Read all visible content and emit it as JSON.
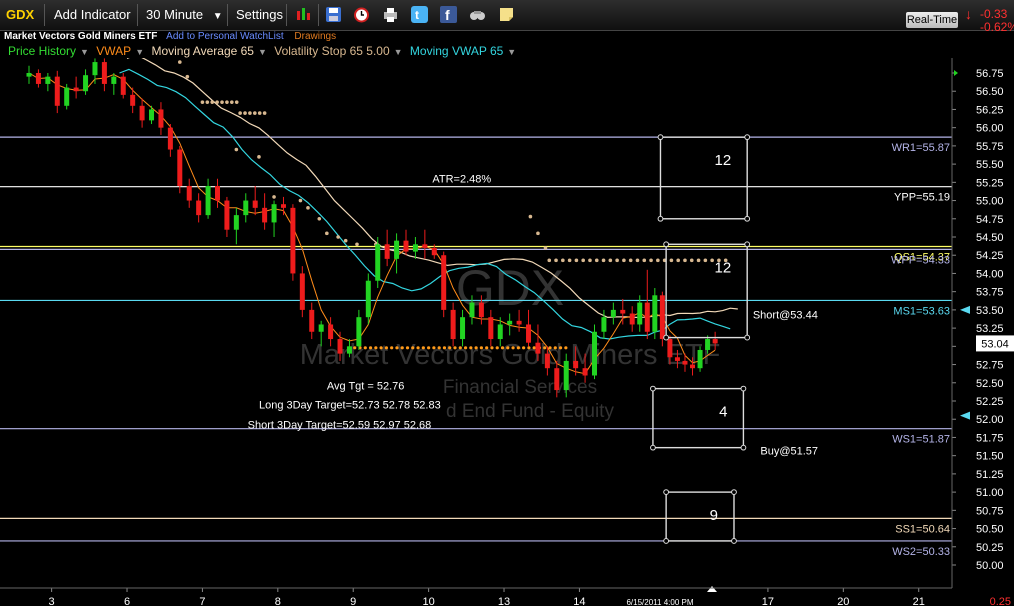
{
  "toolbar": {
    "symbol": "GDX",
    "add_indicator": "Add Indicator",
    "interval": "30 Minute",
    "settings": "Settings",
    "realtime": "Real-Time",
    "change_abs": "-0.33",
    "change_pct": "-0.62%"
  },
  "subheader": {
    "name": "Market Vectors Gold Miners ETF",
    "watchlist": "Add to Personal WatchList",
    "drawings": "Drawings"
  },
  "legend": [
    {
      "label": "Price History",
      "color": "#33dd33"
    },
    {
      "label": "VWAP",
      "color": "#ff8c1a"
    },
    {
      "label": "Moving Average 65",
      "color": "#f2d9b8"
    },
    {
      "label": "Volatility Stop 65 5.00",
      "color": "#d8b890"
    },
    {
      "label": "Moving VWAP 65",
      "color": "#33d6e0"
    }
  ],
  "watermark": {
    "symbol": "GDX",
    "name": "Market Vectors Gold Miners ETF",
    "sector": "Financial Services",
    "type": "d End Fund - Equity"
  },
  "chart_data": {
    "type": "candlestick",
    "ylim": [
      50.0,
      56.85
    ],
    "y_ticks": [
      "56.75",
      "56.50",
      "56.25",
      "56.00",
      "55.75",
      "55.50",
      "55.25",
      "55.00",
      "54.75",
      "54.50",
      "54.25",
      "54.00",
      "53.75",
      "53.50",
      "53.25",
      "53.00",
      "52.75",
      "52.50",
      "52.25",
      "52.00",
      "51.75",
      "51.50",
      "51.25",
      "51.00",
      "50.75",
      "50.50",
      "50.25",
      "50.00"
    ],
    "x_ticks": [
      "3",
      "6",
      "7",
      "8",
      "9",
      "10",
      "13",
      "14",
      "17",
      "20",
      "21"
    ],
    "x_tick_positions": [
      1,
      3,
      5,
      7,
      9,
      11,
      13,
      15,
      20,
      22,
      24
    ],
    "x_date_label": "6/15/2011 4:00 PM",
    "corner_label": "0.25",
    "last_price": "53.04",
    "last_price_value": 53.04,
    "levels": [
      {
        "label": "WR1=55.87",
        "value": 55.87,
        "color": "#b4b4e8"
      },
      {
        "label": "YPP=55.19",
        "value": 55.19,
        "color": "#ffffff"
      },
      {
        "label": "QS1=54.37",
        "value": 54.37,
        "color": "#ffff66"
      },
      {
        "label": "WPP=54.33",
        "value": 54.33,
        "color": "#b4b4e8"
      },
      {
        "label": "MS1=53.63",
        "value": 53.63,
        "color": "#5ad9f0"
      },
      {
        "label": "WS1=51.87",
        "value": 51.87,
        "color": "#b4b4e8"
      },
      {
        "label": "SS1=50.64",
        "value": 50.64,
        "color": "#f2d9b8"
      },
      {
        "label": "WS2=50.33",
        "value": 50.33,
        "color": "#b4b4e8"
      }
    ],
    "annotations": [
      {
        "text": "ATR=2.48%",
        "x": 10.7,
        "y": 55.3
      },
      {
        "text": "Short@53.44",
        "x": 19.2,
        "y": 53.44
      },
      {
        "text": "Buy@51.57",
        "x": 19.4,
        "y": 51.57
      },
      {
        "text": "Avg Tgt = 52.76",
        "x": 7.9,
        "y": 52.46
      },
      {
        "text": "Long 3Day Target=52.73 52.78 52.83",
        "x": 6.1,
        "y": 52.2
      },
      {
        "text": "Short 3Day Target=52.59 52.97 52.68",
        "x": 5.8,
        "y": 51.93
      }
    ],
    "boxes": [
      {
        "number": "12",
        "x0": 16.75,
        "x1": 19.05,
        "y0": 55.87,
        "y1": 54.75
      },
      {
        "number": "12",
        "x0": 16.9,
        "x1": 19.05,
        "y0": 54.4,
        "y1": 53.12
      },
      {
        "number": "4",
        "x0": 16.55,
        "x1": 18.95,
        "y0": 52.42,
        "y1": 51.61
      },
      {
        "number": "9",
        "x0": 16.9,
        "x1": 18.7,
        "y0": 51.0,
        "y1": 50.33
      }
    ],
    "candles": [
      [
        0,
        56.7,
        56.85,
        56.6,
        56.75
      ],
      [
        0.25,
        56.75,
        56.8,
        56.55,
        56.6
      ],
      [
        0.5,
        56.6,
        56.75,
        56.5,
        56.7
      ],
      [
        0.75,
        56.7,
        56.78,
        56.2,
        56.3
      ],
      [
        1,
        56.3,
        56.6,
        56.25,
        56.55
      ],
      [
        1.25,
        56.55,
        56.7,
        56.4,
        56.5
      ],
      [
        1.5,
        56.5,
        56.8,
        56.45,
        56.72
      ],
      [
        1.75,
        56.72,
        56.95,
        56.6,
        56.9
      ],
      [
        2,
        56.9,
        56.95,
        56.5,
        56.6
      ],
      [
        2.25,
        56.6,
        56.75,
        56.45,
        56.7
      ],
      [
        2.5,
        56.7,
        56.75,
        56.4,
        56.45
      ],
      [
        2.75,
        56.45,
        56.55,
        56.2,
        56.3
      ],
      [
        3,
        56.3,
        56.4,
        56.0,
        56.1
      ],
      [
        3.25,
        56.1,
        56.3,
        56.05,
        56.25
      ],
      [
        3.5,
        56.25,
        56.35,
        55.9,
        56.0
      ],
      [
        3.75,
        56.0,
        56.05,
        55.6,
        55.7
      ],
      [
        4,
        55.7,
        55.75,
        55.1,
        55.2
      ],
      [
        4.25,
        55.2,
        55.3,
        54.9,
        55.0
      ],
      [
        4.5,
        55.0,
        55.1,
        54.7,
        54.8
      ],
      [
        4.75,
        54.8,
        55.3,
        54.75,
        55.2
      ],
      [
        5,
        55.2,
        55.3,
        54.9,
        55.0
      ],
      [
        5.25,
        55.0,
        55.05,
        54.5,
        54.6
      ],
      [
        5.5,
        54.6,
        54.9,
        54.4,
        54.8
      ],
      [
        5.75,
        54.8,
        55.1,
        54.7,
        55.0
      ],
      [
        6,
        55.0,
        55.2,
        54.8,
        54.9
      ],
      [
        6.25,
        54.9,
        55.1,
        54.6,
        54.7
      ],
      [
        6.5,
        54.7,
        55.0,
        54.5,
        54.95
      ],
      [
        6.75,
        54.95,
        55.05,
        54.8,
        54.9
      ],
      [
        7,
        54.9,
        54.95,
        53.9,
        54.0
      ],
      [
        7.25,
        54.0,
        54.1,
        53.4,
        53.5
      ],
      [
        7.5,
        53.5,
        53.6,
        53.1,
        53.2
      ],
      [
        7.75,
        53.2,
        53.35,
        53.0,
        53.3
      ],
      [
        8,
        53.3,
        53.4,
        53.0,
        53.1
      ],
      [
        8.25,
        53.1,
        53.2,
        52.8,
        52.9
      ],
      [
        8.5,
        52.9,
        53.1,
        52.85,
        53.0
      ],
      [
        8.75,
        53.0,
        53.5,
        52.95,
        53.4
      ],
      [
        9,
        53.4,
        54.0,
        53.3,
        53.9
      ],
      [
        9.25,
        53.9,
        54.5,
        53.8,
        54.4
      ],
      [
        9.5,
        54.4,
        54.6,
        54.1,
        54.2
      ],
      [
        9.75,
        54.2,
        54.55,
        54.0,
        54.45
      ],
      [
        10,
        54.45,
        54.6,
        54.25,
        54.3
      ],
      [
        10.25,
        54.3,
        54.5,
        54.2,
        54.4
      ],
      [
        10.5,
        54.4,
        54.6,
        54.2,
        54.35
      ],
      [
        10.75,
        54.35,
        54.4,
        54.2,
        54.25
      ],
      [
        11,
        54.25,
        54.3,
        53.4,
        53.5
      ],
      [
        11.25,
        53.5,
        53.6,
        53.0,
        53.1
      ],
      [
        11.5,
        53.1,
        53.5,
        53.0,
        53.4
      ],
      [
        11.75,
        53.4,
        53.7,
        53.3,
        53.6
      ],
      [
        12,
        53.6,
        53.7,
        53.3,
        53.4
      ],
      [
        12.25,
        53.4,
        53.5,
        53.0,
        53.1
      ],
      [
        12.5,
        53.1,
        53.4,
        53.0,
        53.3
      ],
      [
        12.75,
        53.3,
        53.45,
        53.15,
        53.35
      ],
      [
        13,
        53.35,
        53.5,
        53.2,
        53.3
      ],
      [
        13.25,
        53.3,
        53.5,
        53.0,
        53.05
      ],
      [
        13.5,
        53.05,
        53.3,
        52.8,
        52.9
      ],
      [
        13.75,
        52.9,
        53.0,
        52.6,
        52.7
      ],
      [
        14,
        52.7,
        52.8,
        52.3,
        52.4
      ],
      [
        14.25,
        52.4,
        52.9,
        52.3,
        52.8
      ],
      [
        14.5,
        52.8,
        53.0,
        52.6,
        52.7
      ],
      [
        14.75,
        52.7,
        52.9,
        52.5,
        52.6
      ],
      [
        15,
        52.6,
        53.3,
        52.55,
        53.2
      ],
      [
        15.25,
        53.2,
        53.5,
        53.1,
        53.4
      ],
      [
        15.5,
        53.4,
        53.6,
        53.3,
        53.5
      ],
      [
        15.75,
        53.5,
        53.65,
        53.3,
        53.45
      ],
      [
        16,
        53.45,
        53.55,
        53.2,
        53.3
      ],
      [
        16.2,
        53.3,
        53.7,
        53.2,
        53.6
      ],
      [
        16.4,
        53.6,
        54.05,
        53.1,
        53.2
      ],
      [
        16.6,
        53.2,
        53.8,
        53.1,
        53.7
      ],
      [
        16.8,
        53.7,
        53.75,
        53.0,
        53.1
      ],
      [
        17,
        53.1,
        53.15,
        52.75,
        52.85
      ],
      [
        17.2,
        52.85,
        52.95,
        52.7,
        52.8
      ],
      [
        17.4,
        52.8,
        52.9,
        52.65,
        52.75
      ],
      [
        17.6,
        52.75,
        52.85,
        52.6,
        52.7
      ],
      [
        17.8,
        52.7,
        53.0,
        52.65,
        52.95
      ],
      [
        18,
        52.95,
        53.15,
        52.9,
        53.1
      ],
      [
        18.2,
        53.1,
        53.2,
        52.95,
        53.04
      ]
    ]
  }
}
